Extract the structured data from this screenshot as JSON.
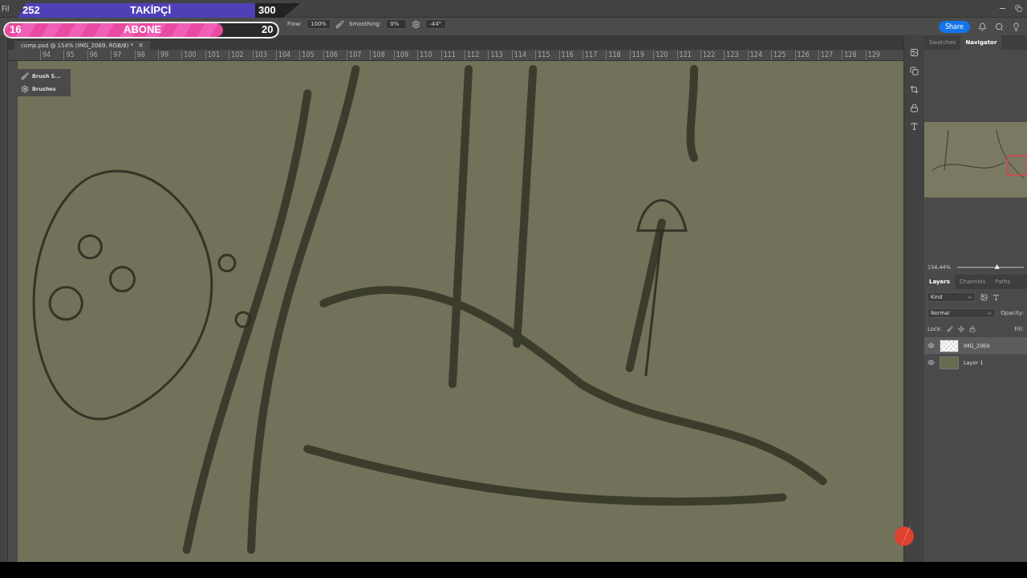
{
  "menu": {
    "first_item": "Fil"
  },
  "header": {
    "share": "Share"
  },
  "options_bar": {
    "flow_label": "Flow:",
    "flow_value": "100%",
    "smoothing_label": "Smoothing:",
    "smoothing_value": "0%",
    "angle_value": "-44°"
  },
  "document_tab": {
    "title": "comp.psd @ 154% (IMG_2069, RGB/8) *",
    "close": "×"
  },
  "ruler": [
    "94",
    "95",
    "96",
    "97",
    "98",
    "99",
    "100",
    "101",
    "102",
    "103",
    "104",
    "105",
    "106",
    "107",
    "108",
    "109",
    "110",
    "111",
    "112",
    "113",
    "114",
    "115",
    "116",
    "117",
    "118",
    "119",
    "120",
    "121",
    "122",
    "123",
    "124",
    "125",
    "126",
    "127",
    "128",
    "129"
  ],
  "floating_panel": {
    "items": [
      {
        "label": "Brush S..."
      },
      {
        "label": "Brushes"
      }
    ]
  },
  "right_panel": {
    "top_tabs": [
      {
        "label": "Swatches",
        "selected": false
      },
      {
        "label": "Navigator",
        "selected": true
      }
    ],
    "zoom": {
      "value": "154,44%",
      "level": 0.6
    },
    "layer_tabs": [
      {
        "label": "Layers",
        "selected": true
      },
      {
        "label": "Channels",
        "selected": false
      },
      {
        "label": "Paths",
        "selected": false
      }
    ],
    "filter": "Kind",
    "blend_mode": "Normal",
    "opacity_label": "Opacity:",
    "lock_label": "Lock:",
    "fill_label": "Fill:",
    "layers": [
      {
        "name": "IMG_2069",
        "kind": "transparent",
        "visible": true,
        "selected": true
      },
      {
        "name": "Layer 1",
        "kind": "fill",
        "visible": true,
        "selected": false
      }
    ]
  },
  "stream_overlay": {
    "followers": {
      "current": "252",
      "label": "TAKİPÇİ",
      "goal": "300",
      "level": 0.84
    },
    "subscribers": {
      "current": "16",
      "label": "ABONE",
      "goal": "20",
      "level": 0.8
    }
  }
}
